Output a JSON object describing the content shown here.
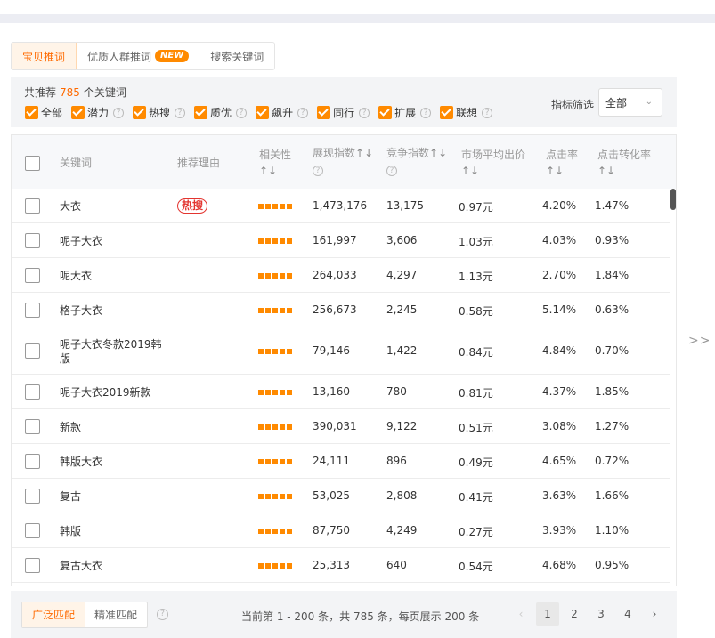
{
  "tabs": [
    {
      "label": "宝贝推词",
      "active": true
    },
    {
      "label": "优质人群推词",
      "badge": "NEW"
    },
    {
      "label": "搜索关键词"
    }
  ],
  "summary": {
    "prefix": "共推荐",
    "count": "785",
    "suffix": "个关键词"
  },
  "filters": [
    "全部",
    "潜力",
    "热搜",
    "质优",
    "飙升",
    "同行",
    "扩展",
    "联想"
  ],
  "metric": {
    "label": "指标筛选",
    "value": "全部"
  },
  "columns": {
    "keyword": "关键词",
    "reason": "推荐理由",
    "relevance": "相关性",
    "impression": "展现指数",
    "competition": "竞争指数",
    "avg_bid": "市场平均出价",
    "ctr": "点击率",
    "cvr": "点击转化率",
    "sort_icon": "↑↓",
    "help_icon": "?"
  },
  "rows": [
    {
      "keyword": "大衣",
      "reason": "热搜",
      "relevance": 5,
      "impression": "1,473,176",
      "competition": "13,175",
      "bid": "0.97元",
      "ctr": "4.20%",
      "cvr": "1.47%"
    },
    {
      "keyword": "呢子大衣",
      "reason": "",
      "relevance": 5,
      "impression": "161,997",
      "competition": "3,606",
      "bid": "1.03元",
      "ctr": "4.03%",
      "cvr": "0.93%"
    },
    {
      "keyword": "呢大衣",
      "reason": "",
      "relevance": 5,
      "impression": "264,033",
      "competition": "4,297",
      "bid": "1.13元",
      "ctr": "2.70%",
      "cvr": "1.84%"
    },
    {
      "keyword": "格子大衣",
      "reason": "",
      "relevance": 5,
      "impression": "256,673",
      "competition": "2,245",
      "bid": "0.58元",
      "ctr": "5.14%",
      "cvr": "0.63%"
    },
    {
      "keyword": "呢子大衣冬款2019韩版",
      "reason": "",
      "relevance": 5,
      "impression": "79,146",
      "competition": "1,422",
      "bid": "0.84元",
      "ctr": "4.84%",
      "cvr": "0.70%"
    },
    {
      "keyword": "呢子大衣2019新款",
      "reason": "",
      "relevance": 5,
      "impression": "13,160",
      "competition": "780",
      "bid": "0.81元",
      "ctr": "4.37%",
      "cvr": "1.85%"
    },
    {
      "keyword": "新款",
      "reason": "",
      "relevance": 5,
      "impression": "390,031",
      "competition": "9,122",
      "bid": "0.51元",
      "ctr": "3.08%",
      "cvr": "1.27%"
    },
    {
      "keyword": "韩版大衣",
      "reason": "",
      "relevance": 5,
      "impression": "24,111",
      "competition": "896",
      "bid": "0.49元",
      "ctr": "4.65%",
      "cvr": "0.72%"
    },
    {
      "keyword": "复古",
      "reason": "",
      "relevance": 5,
      "impression": "53,025",
      "competition": "2,808",
      "bid": "0.41元",
      "ctr": "3.63%",
      "cvr": "1.66%"
    },
    {
      "keyword": "韩版",
      "reason": "",
      "relevance": 5,
      "impression": "87,750",
      "competition": "4,249",
      "bid": "0.27元",
      "ctr": "3.93%",
      "cvr": "1.10%"
    },
    {
      "keyword": "复古大衣",
      "reason": "",
      "relevance": 5,
      "impression": "25,313",
      "competition": "640",
      "bid": "0.54元",
      "ctr": "4.68%",
      "cvr": "0.95%"
    }
  ],
  "expand_arrow": ">>",
  "match": {
    "broad": "广泛匹配",
    "exact": "精准匹配"
  },
  "pagination": {
    "info": "当前第 1 - 200 条，共 785 条，每页展示 200 条",
    "pages": [
      "1",
      "2",
      "3",
      "4"
    ],
    "current": "1",
    "prev": "‹",
    "next": "›"
  },
  "colors": {
    "accent": "#ff8a00",
    "hot": "#e3342f"
  }
}
